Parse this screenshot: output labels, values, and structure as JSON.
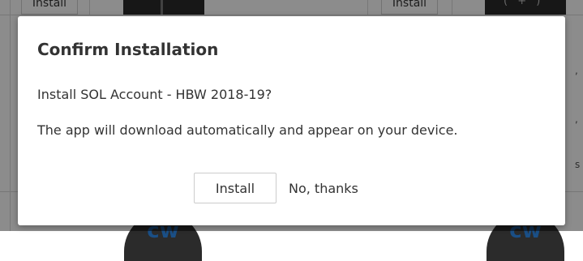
{
  "background": {
    "left_install_label": "Install",
    "right_install_label": "Install",
    "app_icon_text": "cw"
  },
  "dialog": {
    "title": "Confirm Installation",
    "question": "Install SOL Account - HBW 2018-19?",
    "message": "The app will download automatically and appear on your device.",
    "install_label": "Install",
    "decline_label": "No, thanks"
  },
  "colors": {
    "overlay": "rgba(0,0,0,0.45)",
    "dialog_bg": "#ffffff",
    "text": "#333333",
    "button_border": "#cccccc",
    "icon_dark": "#2b2b2b",
    "icon_text": "#1a4f86"
  }
}
